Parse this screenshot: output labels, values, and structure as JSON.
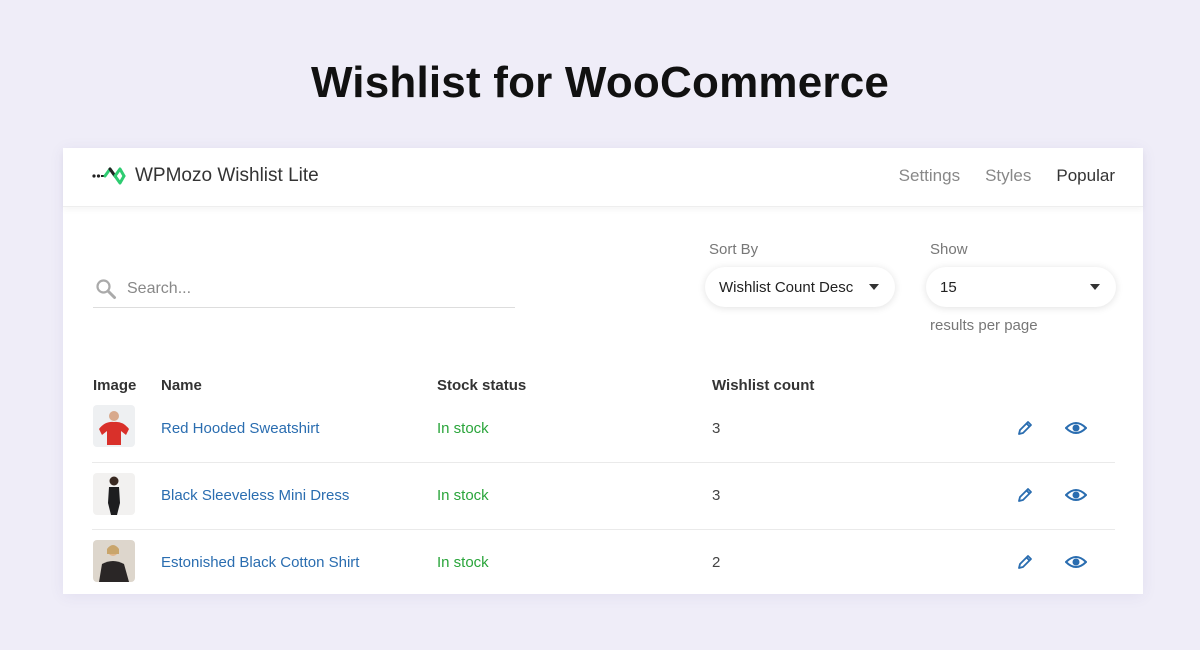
{
  "headline": "Wishlist for WooCommerce",
  "brand": {
    "name": "WPMozo Wishlist Lite",
    "logo_icon": "wpmozo-logo-icon",
    "accent": "#2ecc71"
  },
  "nav": {
    "items": [
      "Settings",
      "Styles",
      "Popular"
    ],
    "active": "Popular"
  },
  "search": {
    "placeholder": "Search...",
    "value": ""
  },
  "sort": {
    "label": "Sort By",
    "value": "Wishlist Count Desc"
  },
  "show": {
    "label": "Show",
    "value": "15",
    "suffix": "results per page"
  },
  "table": {
    "headers": {
      "image": "Image",
      "name": "Name",
      "stock": "Stock status",
      "count": "Wishlist count"
    },
    "rows": [
      {
        "name": "Red Hooded Sweatshirt",
        "stock": "In stock",
        "count": "3",
        "thumb_color": "#d9302a"
      },
      {
        "name": "Black Sleeveless Mini Dress",
        "stock": "In stock",
        "count": "3",
        "thumb_color": "#1d1d1f"
      },
      {
        "name": "Estonished Black Cotton Shirt",
        "stock": "In stock",
        "count": "2",
        "thumb_color": "#2a2626"
      }
    ]
  },
  "colors": {
    "link": "#2a6db0",
    "stock": "#2aa53b",
    "action_icon": "#2a6db0"
  }
}
